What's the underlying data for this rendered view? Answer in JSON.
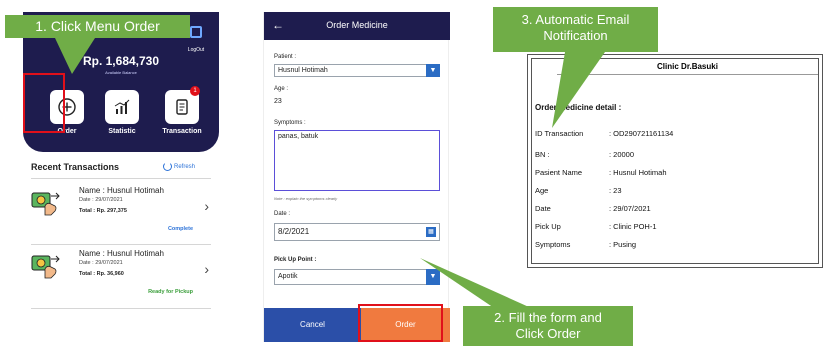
{
  "app": {
    "logout_label": "LogOut",
    "balance": "Rp. 1,684,730",
    "balance_label": "Available Balance",
    "menu": [
      {
        "label": "Order",
        "icon": "plus-circle-icon"
      },
      {
        "label": "Statistic",
        "icon": "bar-chart-icon"
      },
      {
        "label": "Transaction",
        "icon": "receipt-icon"
      }
    ],
    "transaction_badge": "1",
    "recent_title": "Recent Transactions",
    "refresh_label": "Refresh",
    "transactions": [
      {
        "name": "Name : Husnul Hotimah",
        "date": "Date : 29/07/2021",
        "total": "Total : Rp. 297,375",
        "status": "Complete"
      },
      {
        "name": "Name : Husnul Hotimah",
        "date": "Date : 29/07/2021",
        "total": "Total : Rp. 36,960",
        "status": "Ready for Pickup"
      }
    ]
  },
  "form": {
    "back_icon": "arrow-left-icon",
    "title": "Order Medicine",
    "patient_label": "Patient :",
    "patient_value": "Husnul Hotimah",
    "age_label": "Age :",
    "age_value": "23",
    "symptoms_label": "Symptoms :",
    "symptoms_value": "panas, batuk",
    "note": "Note : explain the symptoms clearly",
    "date_label": "Date :",
    "date_value": "8/2/2021",
    "pickup_label": "Pick Up Point :",
    "pickup_value": "Apotik",
    "cancel_label": "Cancel",
    "order_label": "Order"
  },
  "email": {
    "title": "Clinic Dr.Basuki",
    "subtitle": "Order Medicine detail :",
    "rows": [
      {
        "key": "ID Transaction",
        "value": ": OD290721161134"
      },
      {
        "key": "BN :",
        "value": ": 20000"
      },
      {
        "key": "Pasient Name",
        "value": ": Husnul Hotimah"
      },
      {
        "key": "Age",
        "value": ": 23"
      },
      {
        "key": "Date",
        "value": ": 29/07/2021"
      },
      {
        "key": "Pick Up",
        "value": ": Clinic POH-1"
      },
      {
        "key": "Symptoms",
        "value": ": Pusing"
      }
    ]
  },
  "callouts": {
    "step1": "1. Click Menu Order",
    "step2_line1": "2. Fill the form and",
    "step2_line2": "Click Order",
    "step3_line1": "3. Automatic Email",
    "step3_line2": "Notification"
  },
  "colors": {
    "header": "#1e1c4e",
    "callout": "#70ad47",
    "highlight": "#e0101a",
    "order_button": "#f07a3f",
    "cancel_button": "#2b4fa8"
  }
}
